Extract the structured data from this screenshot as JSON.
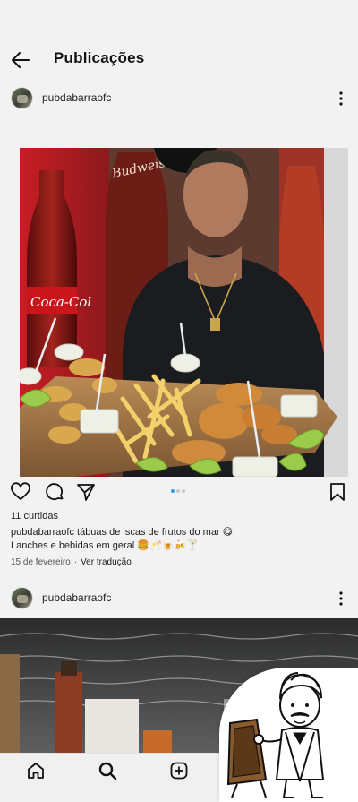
{
  "header": {
    "title": "Publicações",
    "back_icon": "arrow-left-icon"
  },
  "posts": [
    {
      "username": "pubdabarraofc",
      "likes": "11 curtidas",
      "caption_user": "pubdabarraofc",
      "caption_line1": "tábuas de iscas de frutos do mar 😋",
      "caption_line2": "Lanches e bebidas em geral 🍔🥂🍺🍻🍸",
      "date": "15 de fevereiro",
      "translate": "Ver tradução",
      "carousel_count": 3,
      "carousel_active": 0
    },
    {
      "username": "pubdabarraofc"
    }
  ],
  "colors": {
    "accent": "#3897f0",
    "background": "#f2f2f2"
  },
  "bottom_nav": {
    "items": [
      "home-icon",
      "search-icon",
      "add-post-icon"
    ]
  },
  "badge": {
    "icon": "waiter-menu-icon"
  }
}
